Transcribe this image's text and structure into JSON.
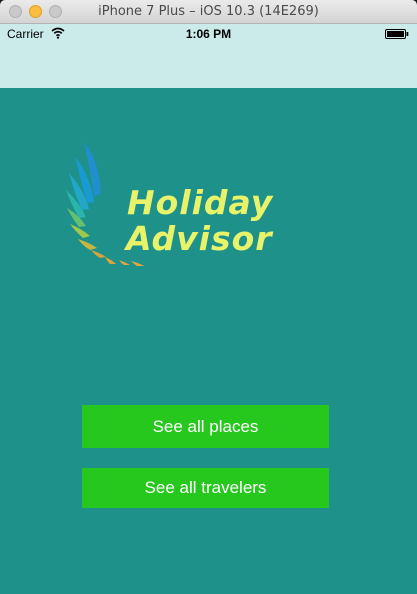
{
  "window": {
    "title": "iPhone 7 Plus – iOS 10.3 (14E269)"
  },
  "status_bar": {
    "carrier": "Carrier",
    "time": "1:06 PM"
  },
  "logo": {
    "line1": "Holiday",
    "line2": "Advisor"
  },
  "buttons": {
    "see_all_places": "See all places",
    "see_all_travelers": "See all travelers"
  },
  "icons": [
    "close-icon",
    "minimize-icon",
    "zoom-icon",
    "wifi-icon",
    "battery-icon",
    "wing-icon"
  ],
  "colors": {
    "content_background": "#1e918a",
    "status_background": "#cbeaea",
    "button_background": "#27c81e",
    "logo_text": "#e9f36a"
  }
}
